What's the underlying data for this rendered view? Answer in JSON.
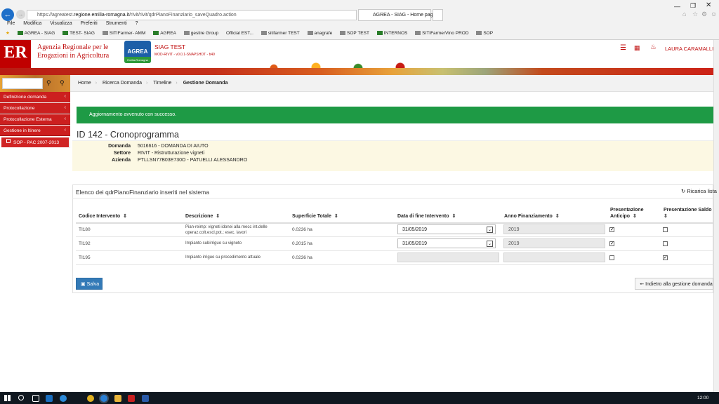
{
  "browser": {
    "url_prefix": "https://agreatest.",
    "url_domain": "regione.emilia-romagna.it",
    "url_path": "/rivit/rivit/qdrPianoFinanziario_saveQuadro.action",
    "tab_title": "AGREA - SIAG - Home page",
    "menu": [
      "File",
      "Modifica",
      "Visualizza",
      "Preferiti",
      "Strumenti",
      "?"
    ],
    "favorites": [
      "AGREA - SIAG",
      "TEST- SIAG",
      "SITIFarmer- AMM",
      "AGREA",
      "gestire Group",
      "Official EST...",
      "sitifarmer TEST",
      "anagrafe",
      "SOP TEST",
      "INTERNOS",
      "SITIFarmerVino PROD",
      "SOP"
    ]
  },
  "header": {
    "logo_text": "ER",
    "agency_line1": "Agenzia Regionale per le",
    "agency_line2": "Erogazioni in Agricoltura",
    "agrea_logo": "AGREA",
    "agrea_sub": "Emilia-Romagna",
    "siag_title": "SIAG TEST",
    "version": "MOD-RIVIT - v0.0.1-SNAPSHOT - b49",
    "user": "LAURA CARAMALLI"
  },
  "sidebar": {
    "items": [
      {
        "label": "Definizione domanda"
      },
      {
        "label": "Protocollazione"
      },
      {
        "label": "Protocollazione Esterna"
      },
      {
        "label": "Gestione in Itinere"
      }
    ],
    "sub_item": "SOP - PAC 2007-2013"
  },
  "breadcrumb": [
    "Home",
    "Ricerca Domanda",
    "Timeline",
    "Gestione Domanda"
  ],
  "alert": "Aggiornamento avvenuto con successo.",
  "page_title": "ID 142 - Cronoprogramma",
  "info": {
    "domanda_label": "Domanda",
    "domanda_value": "5016616 - DOMANDA DI AIUTO",
    "settore_label": "Settore",
    "settore_value": "RIVIT - Ristrutturazione vigneti",
    "azienda_label": "Azienda",
    "azienda_value": "PTLLSN77B03E730O - PATUELLI ALESSANDRO"
  },
  "panel_title": "Elenco dei qdrPianoFinanziario inseriti nel sistema",
  "reload_label": "Ricarica lista",
  "table": {
    "headers": {
      "codice": "Codice Intervento",
      "descrizione": "Descrizione",
      "superficie": "Superficie Totale",
      "data_fine": "Data di fine Intervento",
      "anno": "Anno Finanziamento",
      "anticipo_1": "Presentazione",
      "anticipo_2": "Anticipo",
      "saldo": "Presentazione Saldo"
    },
    "rows": [
      {
        "codice": "TI180",
        "desc1": "Pian-reimp: vigneti idonei alla mecc int.delle",
        "desc2": "operaz.colt.escl.pot.: esec. lavori",
        "superficie": "0.0236 ha",
        "data_fine": "31/05/2019",
        "anno": "2019",
        "anticipo": true,
        "saldo": false
      },
      {
        "codice": "TI192",
        "desc1": "Impianto subirriguo su vigneto",
        "desc2": "",
        "superficie": "0.2015 ha",
        "data_fine": "31/05/2019",
        "anno": "2019",
        "anticipo": true,
        "saldo": false
      },
      {
        "codice": "TI195",
        "desc1": "Impianto irriguo su procedimento attuale",
        "desc2": "",
        "superficie": "0.0236 ha",
        "data_fine": "",
        "anno": "",
        "anticipo": false,
        "saldo": true
      }
    ]
  },
  "buttons": {
    "salva": "Salva",
    "indietro": "Indietro alla gestione domanda"
  },
  "taskbar": {
    "time": "12:00"
  },
  "colors": {
    "brand_red": "#cc1f1f",
    "success": "#1e9a45",
    "primary": "#337ab7",
    "info_bg": "#fcf8e3"
  }
}
